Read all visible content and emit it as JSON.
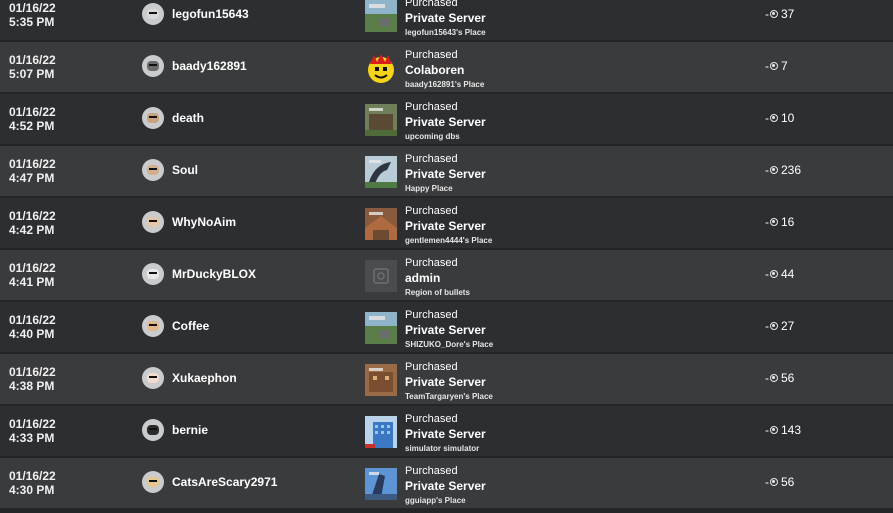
{
  "transactions": [
    {
      "date": "01/16/22",
      "time": "5:35 PM",
      "user": "legofun15643",
      "action": "Purchased",
      "item": "Private Server",
      "place": "legofun15643's Place",
      "amount": "37",
      "sign": "-",
      "thumb": "roblox-grass",
      "skin": "#d8d8d8"
    },
    {
      "date": "01/16/22",
      "time": "5:07 PM",
      "user": "baady162891",
      "action": "Purchased",
      "item": "Colaboren",
      "place": "baady162891's Place",
      "amount": "7",
      "sign": "-",
      "thumb": "yellow-face",
      "skin": "#6b6b6b"
    },
    {
      "date": "01/16/22",
      "time": "4:52 PM",
      "user": "death",
      "action": "Purchased",
      "item": "Private Server",
      "place": "upcoming dbs",
      "amount": "10",
      "sign": "-",
      "thumb": "roblox-house",
      "skin": "#c9a27e"
    },
    {
      "date": "01/16/22",
      "time": "4:47 PM",
      "user": "Soul",
      "action": "Purchased",
      "item": "Private Server",
      "place": "Happy Place",
      "amount": "236",
      "sign": "-",
      "thumb": "roblox-dragon",
      "skin": "#d1b08f"
    },
    {
      "date": "01/16/22",
      "time": "4:42 PM",
      "user": "WhyNoAim",
      "action": "Purchased",
      "item": "Private Server",
      "place": "gentlemen4444's Place",
      "amount": "16",
      "sign": "-",
      "thumb": "roblox-brick",
      "skin": "#e3c7a8"
    },
    {
      "date": "01/16/22",
      "time": "4:41 PM",
      "user": "MrDuckyBLOX",
      "action": "Purchased",
      "item": "admin",
      "place": "Region of bullets",
      "amount": "44",
      "sign": "-",
      "thumb": "placeholder",
      "skin": "#e8e8e8"
    },
    {
      "date": "01/16/22",
      "time": "4:40 PM",
      "user": "Coffee",
      "action": "Purchased",
      "item": "Private Server",
      "place": "SHIZUKO_Dore's Place",
      "amount": "27",
      "sign": "-",
      "thumb": "roblox-grass",
      "skin": "#e0b98f"
    },
    {
      "date": "01/16/22",
      "time": "4:38 PM",
      "user": "Xukaephon",
      "action": "Purchased",
      "item": "Private Server",
      "place": "TeamTargaryen's Place",
      "amount": "56",
      "sign": "-",
      "thumb": "roblox-tower",
      "skin": "#f1dcd0"
    },
    {
      "date": "01/16/22",
      "time": "4:33 PM",
      "user": "bernie",
      "action": "Purchased",
      "item": "Private Server",
      "place": "simulator simulator",
      "amount": "143",
      "sign": "-",
      "thumb": "roblox-blue-building",
      "skin": "#2b2b2b"
    },
    {
      "date": "01/16/22",
      "time": "4:30 PM",
      "user": "CatsAreScary2971",
      "action": "Purchased",
      "item": "Private Server",
      "place": "gguiapp's Place",
      "amount": "56",
      "sign": "-",
      "thumb": "roblox-sky",
      "skin": "#e5c88e"
    }
  ],
  "icons": {
    "currency": "robux-icon"
  },
  "colors": {
    "row_odd": "#2c2e31",
    "row_even": "#393b3d",
    "text": "#ffffff"
  }
}
